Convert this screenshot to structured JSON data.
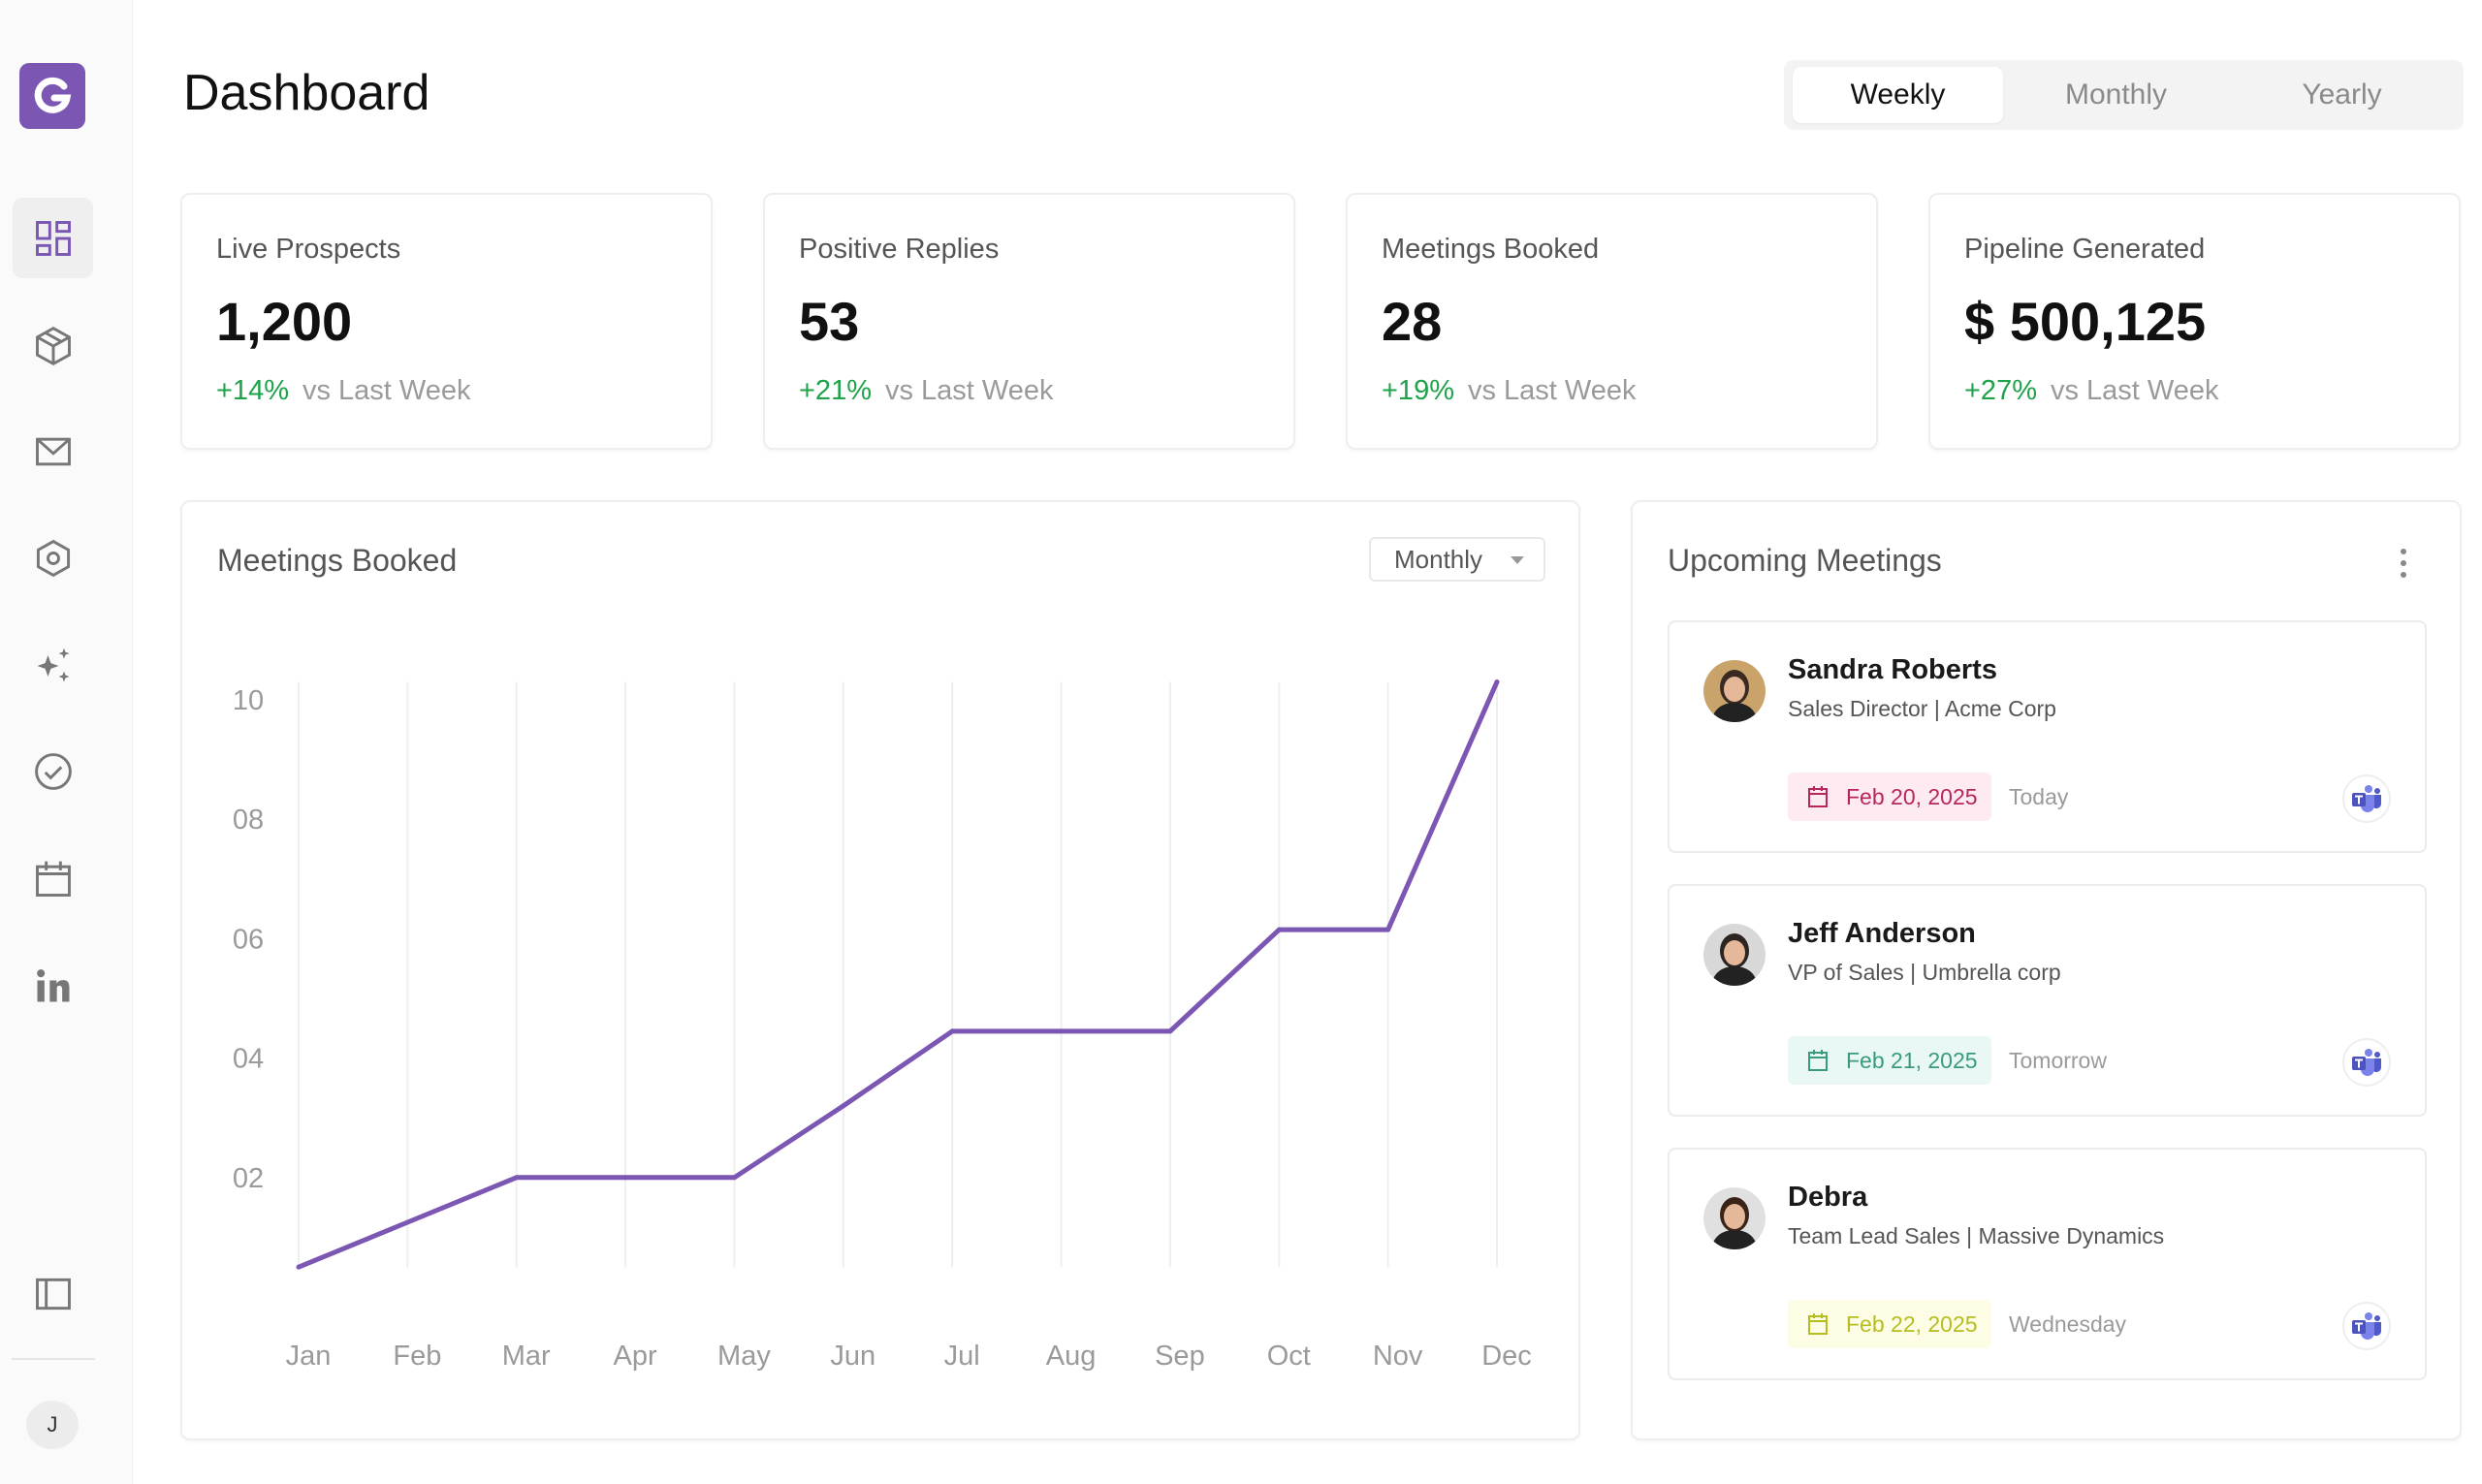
{
  "app": {
    "logo_letter": "G",
    "brand_color": "#7b57b3"
  },
  "sidebar": {
    "items": [
      {
        "name": "dashboard",
        "icon": "grid-icon",
        "active": true
      },
      {
        "name": "products",
        "icon": "box-icon",
        "active": false
      },
      {
        "name": "mail",
        "icon": "mail-icon",
        "active": false
      },
      {
        "name": "settings",
        "icon": "hexagon-settings-icon",
        "active": false
      },
      {
        "name": "ai",
        "icon": "sparkles-icon",
        "active": false
      },
      {
        "name": "tasks",
        "icon": "check-circle-icon",
        "active": false
      },
      {
        "name": "calendar",
        "icon": "calendar-icon",
        "active": false
      },
      {
        "name": "linkedin",
        "icon": "linkedin-icon",
        "active": false
      }
    ],
    "collapse_icon": "sidebar-panel-icon",
    "user_initial": "J"
  },
  "header": {
    "title": "Dashboard",
    "tabs": [
      {
        "label": "Weekly",
        "active": true
      },
      {
        "label": "Monthly",
        "active": false
      },
      {
        "label": "Yearly",
        "active": false
      }
    ]
  },
  "stats": [
    {
      "label": "Live Prospects",
      "value": "1,200",
      "change": "+14%",
      "comparison": "vs Last Week"
    },
    {
      "label": "Positive Replies",
      "value": "53",
      "change": "+21%",
      "comparison": "vs Last Week"
    },
    {
      "label": "Meetings Booked",
      "value": "28",
      "change": "+19%",
      "comparison": "vs Last Week"
    },
    {
      "label": "Pipeline Generated",
      "value": "$ 500,125",
      "change": "+27%",
      "comparison": "vs Last Week"
    }
  ],
  "chart_panel": {
    "title": "Meetings Booked",
    "dropdown_value": "Monthly"
  },
  "chart_data": {
    "type": "line",
    "categories": [
      "Jan",
      "Feb",
      "Mar",
      "Apr",
      "May",
      "Jun",
      "Jul",
      "Aug",
      "Sep",
      "Oct",
      "Nov",
      "Dec"
    ],
    "values": [
      0.5,
      1.25,
      2,
      2,
      2,
      3.2,
      4.45,
      4.45,
      4.45,
      6.15,
      6.15,
      10.3
    ],
    "y_ticks": [
      "02",
      "04",
      "06",
      "08",
      "10"
    ],
    "ylim": [
      0,
      10.3
    ],
    "grid": "vertical",
    "line_color": "#7b57b3"
  },
  "meetings_panel": {
    "title": "Upcoming Meetings",
    "items": [
      {
        "name": "Sandra Roberts",
        "role": "Sales Director | Acme Corp",
        "date": "Feb 20, 2025",
        "relative": "Today",
        "pill_bg": "#fdebf1",
        "pill_color": "#b8265e",
        "platform": "teams-icon"
      },
      {
        "name": "Jeff Anderson",
        "role": "VP of Sales | Umbrella corp",
        "date": "Feb 21, 2025",
        "relative": "Tomorrow",
        "pill_bg": "#eaf8f5",
        "pill_color": "#3a9a80",
        "platform": "teams-icon"
      },
      {
        "name": "Debra",
        "role": "Team Lead Sales | Massive Dynamics",
        "date": "Feb 22, 2025",
        "relative": "Wednesday",
        "pill_bg": "#fdfde6",
        "pill_color": "#b5bd1f",
        "platform": "teams-icon"
      }
    ]
  }
}
